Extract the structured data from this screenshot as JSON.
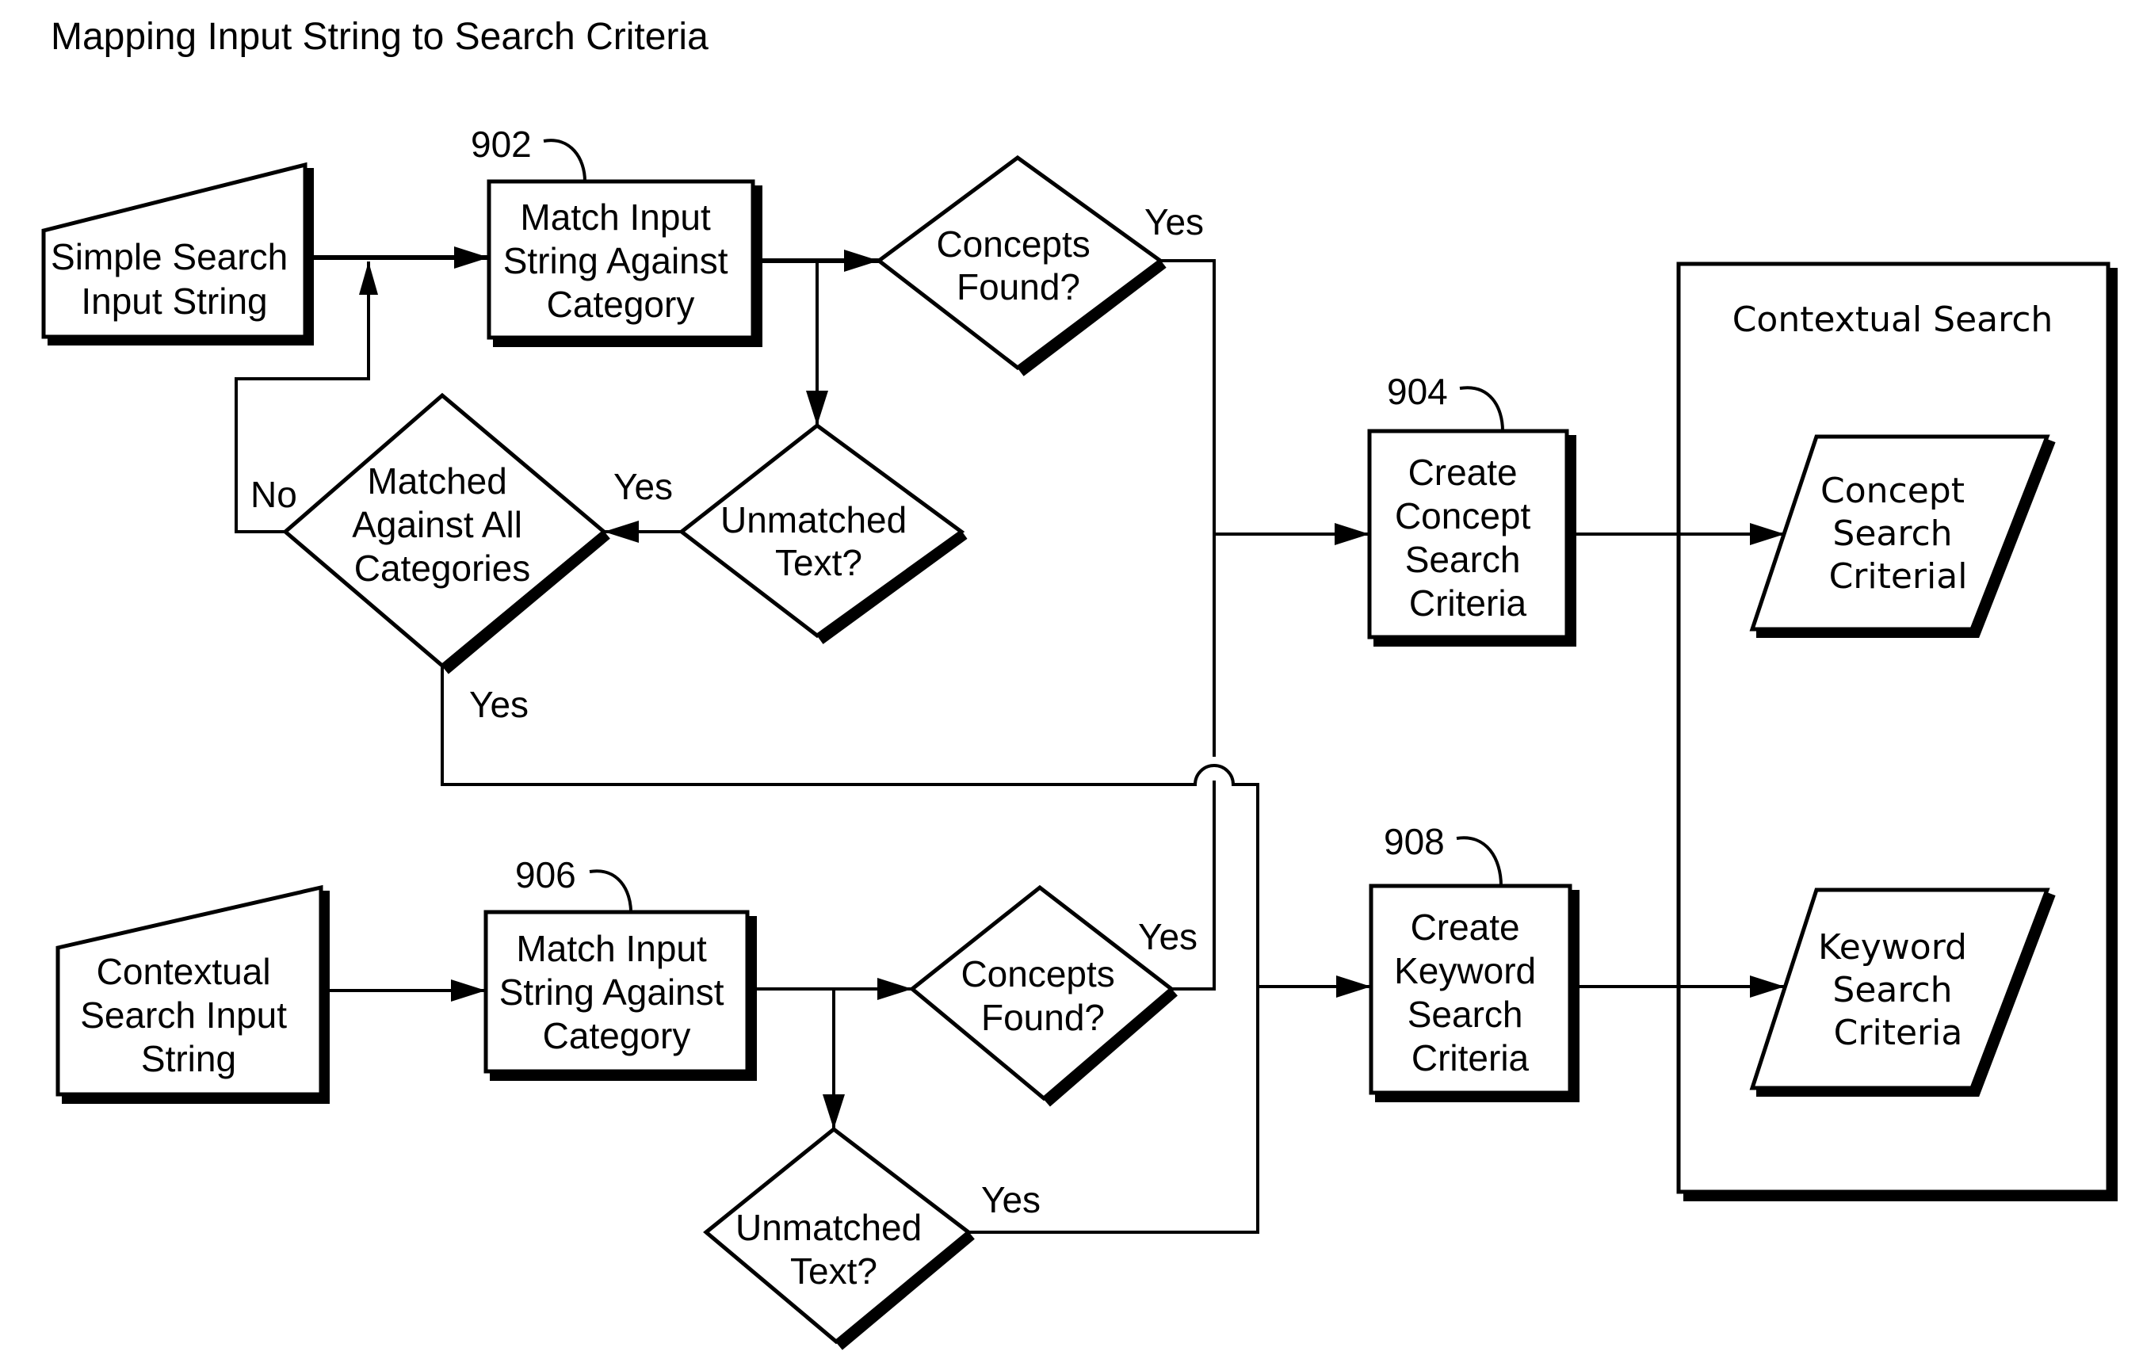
{
  "title": "Mapping Input String to Search Criteria",
  "inputs": {
    "simple": [
      "Simple Search",
      "Input String"
    ],
    "contextual": [
      "Contextual",
      "Search Input",
      "String"
    ]
  },
  "processes": {
    "p902": {
      "ref": "902",
      "lines": [
        "Match Input",
        "String Against",
        "Category"
      ]
    },
    "p906": {
      "ref": "906",
      "lines": [
        "Match Input",
        "String Against",
        "Category"
      ]
    },
    "p904": {
      "ref": "904",
      "lines": [
        "Create",
        "Concept",
        "Search",
        "Criteria"
      ]
    },
    "p908": {
      "ref": "908",
      "lines": [
        "Create",
        "Keyword",
        "Search",
        "Criteria"
      ]
    }
  },
  "decisions": {
    "concepts_top": [
      "Concepts",
      "Found?"
    ],
    "unmatched_top": [
      "Unmatched",
      "Text?"
    ],
    "matched_all": [
      "Matched",
      "Against All",
      "Categories"
    ],
    "concepts_bottom": [
      "Concepts",
      "Found?"
    ],
    "unmatched_bottom": [
      "Unmatched",
      "Text?"
    ]
  },
  "edge_labels": {
    "concepts_top_yes": "Yes",
    "unmatched_top_yes": "Yes",
    "matched_no": "No",
    "matched_yes": "Yes",
    "concepts_bottom_yes": "Yes",
    "unmatched_bottom_yes": "Yes"
  },
  "container": {
    "title": "Contextual Search",
    "outputs": {
      "concept": [
        "Concept",
        "Search",
        "Criterial"
      ],
      "keyword": [
        "Keyword",
        "Search",
        "Criteria"
      ]
    }
  }
}
